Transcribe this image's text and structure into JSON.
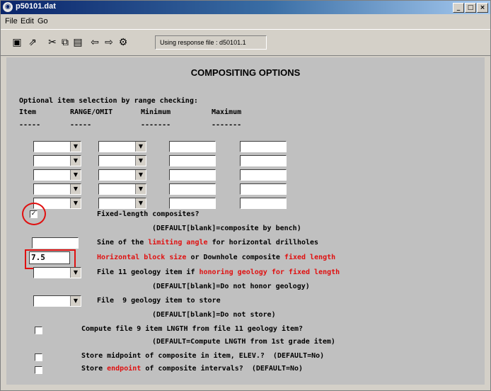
{
  "window": {
    "title": "p50101.dat",
    "min_label": "_",
    "max_label": "□",
    "close_label": "×"
  },
  "menu": [
    "File",
    "Edit",
    "Go"
  ],
  "toolbar": {
    "response_label": "Using response file : d50101.1",
    "icons": [
      "save-icon",
      "export-icon",
      "cut-icon",
      "copy-icon",
      "paste-icon",
      "back-icon",
      "forward-icon",
      "go-icon"
    ]
  },
  "content": {
    "heading": "COMPOSITING OPTIONS",
    "range_title": "Optional item selection by range checking:",
    "columns": [
      "Item",
      "RANGE/OMIT",
      "Minimum",
      "Maximum"
    ],
    "dashes": [
      "-----",
      "-----",
      "-------",
      "-------"
    ],
    "fixed_length": {
      "label": "Fixed-length composites?",
      "default": "(DEFAULT[blank]=composite by bench)",
      "checked": true
    },
    "sine_row": {
      "pre": "Sine of the ",
      "red": "limiting angle",
      "post": " for horizontal drillholes"
    },
    "block_row": {
      "value": "7.5",
      "red1": "Horizontal block size",
      "mid": " or Downhole composite ",
      "red2": "fixed length"
    },
    "file11_row": {
      "pre": "File 11 geology item if ",
      "red": "honoring geology for fixed length",
      "default": "(DEFAULT[blank]=Do not honor geology)"
    },
    "file9_row": {
      "label": "File  9 geology item to store",
      "default": "(DEFAULT[blank]=Do not store)"
    },
    "compute_row": {
      "label": "Compute file 9 item LNGTH from file 11 geology item?",
      "default": "(DEFAULT=Compute LNGTH from 1st grade item)"
    },
    "midpoint_row": {
      "label": "Store midpoint of composite in item, ELEV.?  (DEFAULT=No)"
    },
    "endpoint_row": {
      "pre": "Store ",
      "red": "endpoint",
      "post": " of composite intervals?  (DEFAULT=No)"
    }
  },
  "colors": {
    "accent_red": "#e01010",
    "title_blue": "#0a246a"
  }
}
